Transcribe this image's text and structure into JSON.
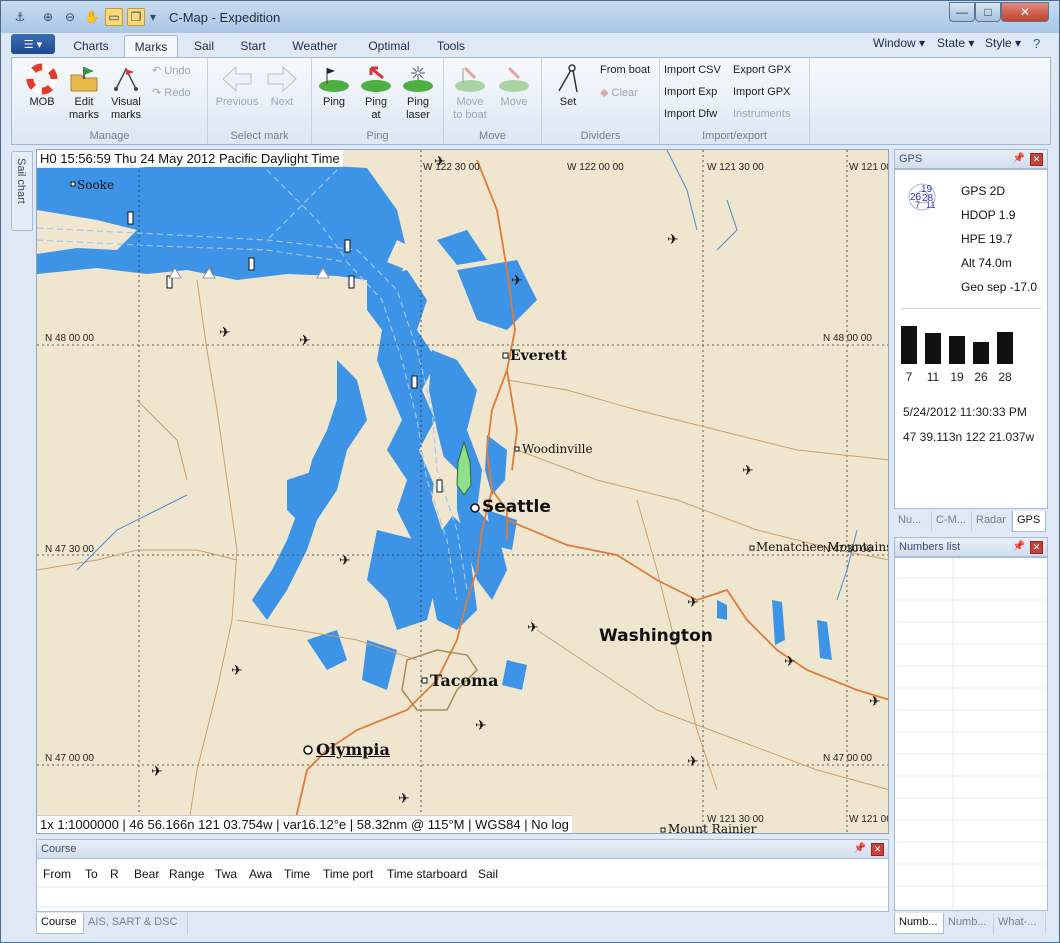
{
  "window": {
    "title": "C-Map - Expedition",
    "controls": {
      "minimize": "—",
      "maximize": "□",
      "close": "✕"
    }
  },
  "ribbon": {
    "tabs": [
      "Charts",
      "Marks",
      "Sail",
      "Start",
      "Weather",
      "Optimal",
      "Tools"
    ],
    "selected_tab": "Marks",
    "right_menus": [
      "Window",
      "State",
      "Style"
    ],
    "groups": {
      "manage": {
        "label": "Manage",
        "mob": "MOB",
        "edit_marks_1": "Edit",
        "edit_marks_2": "marks",
        "visual_marks_1": "Visual",
        "visual_marks_2": "marks",
        "undo": "Undo",
        "redo": "Redo"
      },
      "select_mark": {
        "label": "Select mark",
        "previous": "Previous",
        "next": "Next"
      },
      "ping": {
        "label": "Ping",
        "ping": "Ping",
        "ping_at_1": "Ping",
        "ping_at_2": "at",
        "ping_laser_1": "Ping",
        "ping_laser_2": "laser"
      },
      "move": {
        "label": "Move",
        "move_to_boat_1": "Move",
        "move_to_boat_2": "to boat",
        "move": "Move"
      },
      "dividers": {
        "label": "Dividers",
        "set": "Set",
        "from_boat": "From boat",
        "clear": "Clear"
      },
      "import_export": {
        "label": "Import/export",
        "import_csv": "Import CSV",
        "export_gpx": "Export GPX",
        "import_exp": "Import Exp",
        "import_gpx": "Import GPX",
        "import_dfw": "Import Dfw",
        "instruments": "Instruments"
      }
    }
  },
  "side_tab": {
    "label": "Sail chart"
  },
  "chart": {
    "time": "H0 15:56:59 Thu 24 May 2012 Pacific Daylight Time",
    "status": "1x 1:1000000 | 46 56.166n 121 03.754w | var16.12°e | 58.32nm @ 115°M | WGS84 | No log",
    "cities": {
      "seattle": "Seattle",
      "everett": "Everett",
      "tacoma": "Tacoma",
      "olympia": "Olympia",
      "woodinville": "Woodinville",
      "sooke": "Sooke",
      "menatchee": "Menatchee Mountains",
      "rainier": "Mount Rainier",
      "state": "Washington"
    },
    "lon_labels": {
      "w1": "W 122 30 00",
      "w2": "W 122 00 00",
      "w3": "W 121 30 00",
      "w4": "W 121 00"
    },
    "lat_labels": {
      "n1": "N 48 00 00",
      "n2": "N 47 30 00",
      "n3": "N 47 00 00"
    }
  },
  "gps_panel": {
    "title": "GPS",
    "sky_labels": {
      "a": "19",
      "b": "26",
      "c": "28",
      "d": "7",
      "e": "11"
    },
    "fix": "GPS  2D",
    "hdop": "HDOP   1.9",
    "hpe": "HPE  19.7",
    "alt": "Alt  74.0m",
    "geo_sep": "Geo sep  -17.0",
    "satellites": [
      {
        "id": "7",
        "strength": 0.95
      },
      {
        "id": "11",
        "strength": 0.78
      },
      {
        "id": "19",
        "strength": 0.7
      },
      {
        "id": "26",
        "strength": 0.55
      },
      {
        "id": "28",
        "strength": 0.8
      }
    ],
    "datetime": "5/24/2012 11:30:33 PM",
    "position": "47 39.113n  122 21.037w",
    "tabs": [
      "Nu...",
      "C-M...",
      "Radar",
      "GPS"
    ]
  },
  "numbers_panel": {
    "title": "Numbers list",
    "tabs": [
      "Numb...",
      "Numb...",
      "What-..."
    ]
  },
  "course_panel": {
    "title": "Course",
    "columns": [
      "From",
      "To",
      "R",
      "Bear",
      "Range",
      "Twa",
      "Awa",
      "Time",
      "Time port",
      "Time starboard",
      "Sail"
    ],
    "tabs": [
      "Course",
      "AIS, SART & DSC"
    ]
  }
}
